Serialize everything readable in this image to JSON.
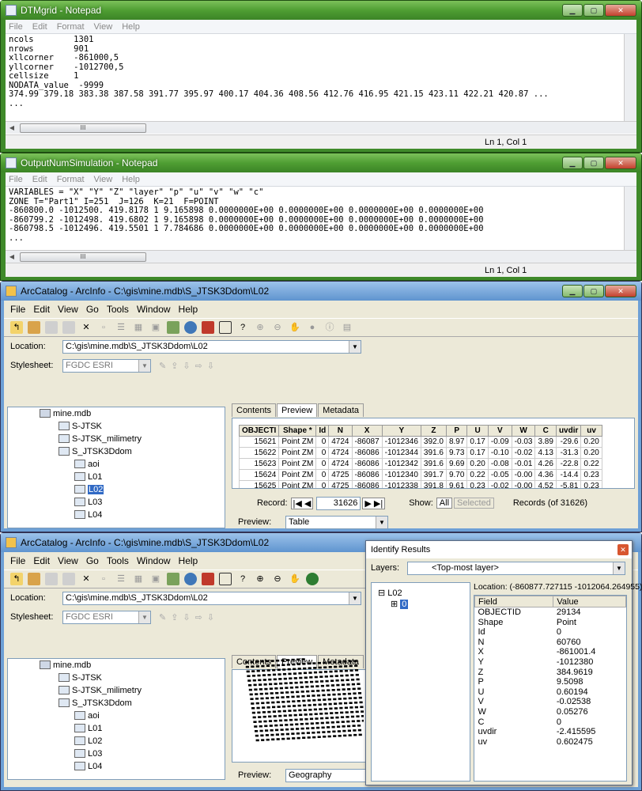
{
  "notepad1": {
    "title": "DTMgrid - Notepad",
    "menu": [
      "File",
      "Edit",
      "Format",
      "View",
      "Help"
    ],
    "lines": [
      "ncols        1301",
      "nrows        901",
      "xllcorner    -861000,5",
      "yllcorner    -1012700,5",
      "cellsize     1",
      "NODATA_value  -9999",
      "374.99 379.18 383.38 387.58 391.77 395.97 400.17 404.36 408.56 412.76 416.95 421.15 423.11 422.21 420.87 ...",
      "..."
    ],
    "status": "Ln 1, Col 1"
  },
  "notepad2": {
    "title": "OutputNumSimulation - Notepad",
    "menu": [
      "File",
      "Edit",
      "Format",
      "View",
      "Help"
    ],
    "lines": [
      "VARIABLES = \"X\" \"Y\" \"Z\" \"layer\" \"p\" \"u\" \"v\" \"w\" \"c\"",
      "ZONE T=\"Part1\" I=251  J=126  K=21  F=POINT",
      "-860800.0 -1012500. 419.8178 1 9.165898 0.0000000E+00 0.0000000E+00 0.0000000E+00 0.0000000E+00",
      "-860799.2 -1012498. 419.6802 1 9.165898 0.0000000E+00 0.0000000E+00 0.0000000E+00 0.0000000E+00",
      "-860798.5 -1012496. 419.5501 1 7.784686 0.0000000E+00 0.0000000E+00 0.0000000E+00 0.0000000E+00",
      "..."
    ],
    "status": "Ln 1, Col 1"
  },
  "arc1": {
    "title": "ArcCatalog - ArcInfo - C:\\gis\\mine.mdb\\S_JTSK3Ddom\\L02",
    "menu": [
      "File",
      "Edit",
      "View",
      "Go",
      "Tools",
      "Window",
      "Help"
    ],
    "location_label": "Location:",
    "location_value": "C:\\gis\\mine.mdb\\S_JTSK3Ddom\\L02",
    "stylesheet_label": "Stylesheet:",
    "stylesheet_value": "FGDC ESRI",
    "tree": [
      "mine.mdb",
      "S-JTSK",
      "S-JTSK_milimetry",
      "S_JTSK3Ddom",
      "aoi",
      "L01",
      "L02",
      "L03",
      "L04"
    ],
    "tabs": [
      "Contents",
      "Preview",
      "Metadata"
    ],
    "columns": [
      "OBJECTI",
      "Shape *",
      "Id",
      "N",
      "X",
      "Y",
      "Z",
      "P",
      "U",
      "V",
      "W",
      "C",
      "uvdir",
      "uv"
    ],
    "rows": [
      [
        "15621",
        "Point ZM",
        "0",
        "4724",
        "-86087",
        "-1012346",
        "392.0",
        "8.97",
        "0.17",
        "-0.09",
        "-0.03",
        "3.89",
        "-29.6",
        "0.20"
      ],
      [
        "15622",
        "Point ZM",
        "0",
        "4724",
        "-86086",
        "-1012344",
        "391.6",
        "9.73",
        "0.17",
        "-0.10",
        "-0.02",
        "4.13",
        "-31.3",
        "0.20"
      ],
      [
        "15623",
        "Point ZM",
        "0",
        "4724",
        "-86086",
        "-1012342",
        "391.6",
        "9.69",
        "0.20",
        "-0.08",
        "-0.01",
        "4.26",
        "-22.8",
        "0.22"
      ],
      [
        "15624",
        "Point ZM",
        "0",
        "4725",
        "-86086",
        "-1012340",
        "391.7",
        "9.70",
        "0.22",
        "-0.05",
        "-0.00",
        "4.36",
        "-14.4",
        "0.23"
      ],
      [
        "15625",
        "Point ZM",
        "0",
        "4725",
        "-86086",
        "-1012338",
        "391.8",
        "9.61",
        "0.23",
        "-0.02",
        "-0.00",
        "4.52",
        "-5.81",
        "0.23"
      ]
    ],
    "record_label": "Record:",
    "record_value": "31626",
    "show_label": "Show:",
    "show_all": "All",
    "show_selected": "Selected",
    "records_of": "Records (of 31626)",
    "preview_label": "Preview:",
    "preview_value": "Table"
  },
  "arc2": {
    "title": "ArcCatalog - ArcInfo - C:\\gis\\mine.mdb\\S_JTSK3Ddom\\L02",
    "menu": [
      "File",
      "Edit",
      "View",
      "Go",
      "Tools",
      "Window",
      "Help"
    ],
    "location_label": "Location:",
    "location_value": "C:\\gis\\mine.mdb\\S_JTSK3Ddom\\L02",
    "stylesheet_label": "Stylesheet:",
    "stylesheet_value": "FGDC ESRI",
    "tree": [
      "mine.mdb",
      "S-JTSK",
      "S-JTSK_milimetry",
      "S_JTSK3Ddom",
      "aoi",
      "L01",
      "L02",
      "L03",
      "L04"
    ],
    "tabs": [
      "Contents",
      "Preview",
      "Metadata"
    ],
    "preview_label": "Preview:",
    "preview_value": "Geography"
  },
  "identify": {
    "title": "Identify Results",
    "layers_label": "Layers:",
    "layers_value": "<Top-most layer>",
    "node": "L02",
    "subnode": "0",
    "location": "Location: (-860877.727115 -1012064.264955)",
    "field_header": "Field",
    "value_header": "Value",
    "fields": [
      [
        "OBJECTID",
        "29134"
      ],
      [
        "Shape",
        "Point"
      ],
      [
        "Id",
        "0"
      ],
      [
        "N",
        "60760"
      ],
      [
        "X",
        "-861001.4"
      ],
      [
        "Y",
        "-1012380"
      ],
      [
        "Z",
        "384.9619"
      ],
      [
        "P",
        "9.5098"
      ],
      [
        "U",
        "0.60194"
      ],
      [
        "V",
        "-0.02538"
      ],
      [
        "W",
        "0.05276"
      ],
      [
        "C",
        "0"
      ],
      [
        "uvdir",
        "-2.415595"
      ],
      [
        "uv",
        "0.602475"
      ]
    ]
  },
  "colors": {
    "title_green": "#4f9e33",
    "classic_bg": "#ece9d8",
    "select_blue": "#316ac5"
  }
}
